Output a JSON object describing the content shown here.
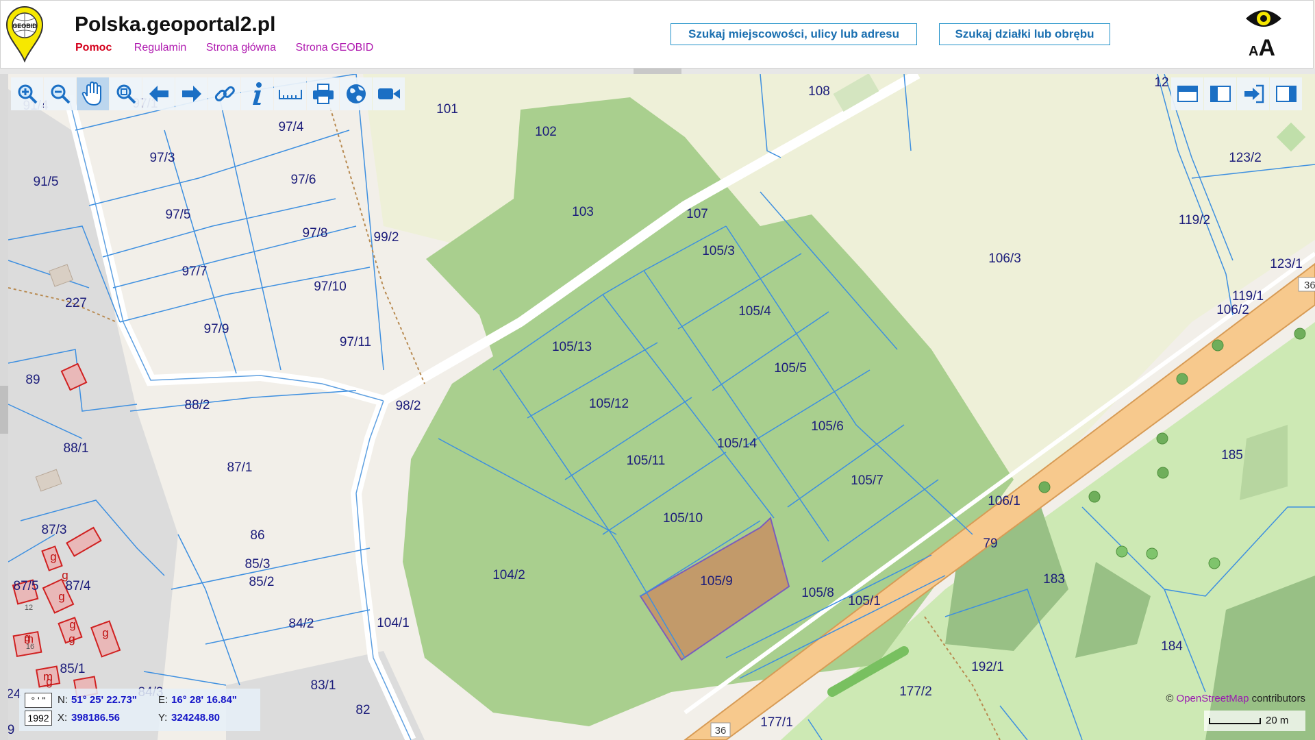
{
  "header": {
    "site_title": "Polska.geoportal2.pl",
    "links": {
      "help": "Pomoc",
      "terms": "Regulamin",
      "home": "Strona główna",
      "geobid": "Strona GEOBID"
    },
    "search_address": "Szukaj miejscowości, ulicy lub adresu",
    "search_parcel": "Szukaj działki lub obrębu",
    "logo_text": "GEOBID",
    "font_size_glyph_small": "A",
    "font_size_glyph_large": "A"
  },
  "toolbar": {
    "tools": [
      "zoom-in",
      "zoom-out",
      "pan",
      "zoom-extent",
      "back",
      "forward",
      "link",
      "info",
      "measure",
      "print",
      "globe",
      "camera"
    ],
    "active_tool": "pan"
  },
  "right_tools": [
    "panel-top",
    "panel-left",
    "exit",
    "panel-right"
  ],
  "map": {
    "parcel_labels": [
      "91/4",
      "97/1",
      "97/4",
      "97/3",
      "97/6",
      "91/5",
      "97/5",
      "97/8",
      "99/2",
      "97/7",
      "227",
      "97/10",
      "97/9",
      "97/11",
      "89",
      "88/2",
      "98/2",
      "88/1",
      "87/1",
      "87/3",
      "86",
      "87/5",
      "87/4",
      "85/3",
      "85/2",
      "84/2",
      "104/1",
      "85/1",
      "84/3",
      "83/1",
      "82",
      "101",
      "102",
      "103",
      "107",
      "105/3",
      "105/4",
      "105/5",
      "105/6",
      "105/7",
      "105/8",
      "105/13",
      "105/12",
      "105/11",
      "105/10",
      "105/14",
      "105/9",
      "104/2",
      "105/1",
      "108",
      "12",
      "123/2",
      "119/2",
      "106/3",
      "123/1",
      "119/1",
      "106/2",
      "106/1",
      "185",
      "79",
      "183",
      "184",
      "192/1",
      "177/2",
      "177/1",
      "24",
      "9"
    ],
    "road_numbers": [
      "36",
      "36"
    ],
    "building_labels": [
      "g",
      "g",
      "g",
      "g",
      "g",
      "g",
      "g",
      "g",
      "m",
      "m",
      "12",
      "16"
    ],
    "colors": {
      "forest": "#a9cf8e",
      "meadow": "#eef0d8",
      "road": "#f7c98d",
      "selected_parcel": "#c29a6a",
      "parcel_line": "#3d8fe0",
      "label": "#1b1c7a"
    }
  },
  "coords": {
    "mode1": "° ' \"",
    "mode2": "1992",
    "n_label": "N:",
    "n_value": "51° 25' 22.73\"",
    "e_label": "E:",
    "e_value": "16° 28' 16.84\"",
    "x_label": "X:",
    "x_value": "398186.56",
    "y_label": "Y:",
    "y_value": "324248.80"
  },
  "attribution": {
    "prefix": "©",
    "link": "OpenStreetMap",
    "suffix": "contributors"
  },
  "scale": {
    "label": "20 m"
  }
}
